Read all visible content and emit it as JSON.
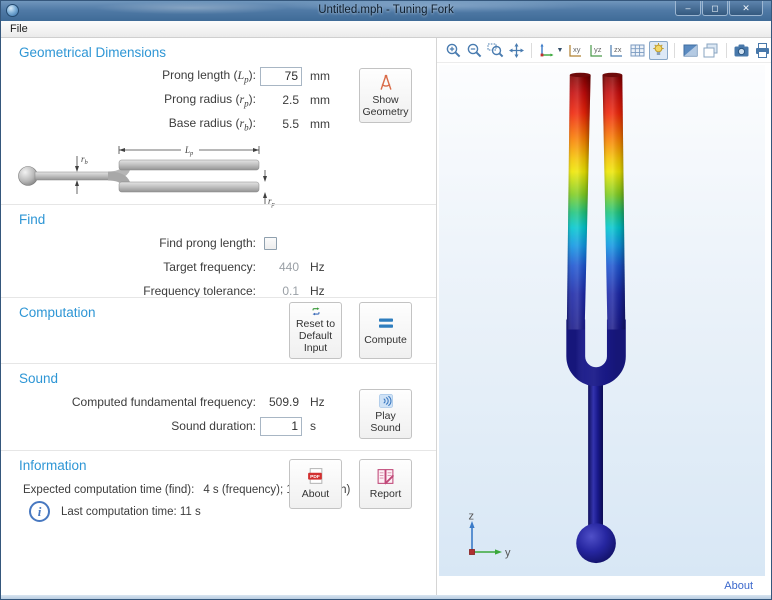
{
  "window": {
    "title": "Untitled.mph - Tuning Fork",
    "menu_items": [
      "File"
    ],
    "controls": {
      "minimize": "–",
      "maximize": "◻",
      "close": "✕"
    }
  },
  "form": {
    "geometry": {
      "title": "Geometrical Dimensions",
      "rows": [
        {
          "label_prefix": "Prong length (",
          "symbol": "L",
          "subscript": "p",
          "label_suffix": "):",
          "value": "75",
          "unit": "mm"
        },
        {
          "label_prefix": "Prong radius (",
          "symbol": "r",
          "subscript": "p",
          "label_suffix": "):",
          "value": "2.5",
          "unit": "mm"
        },
        {
          "label_prefix": "Base radius (",
          "symbol": "r",
          "subscript": "b",
          "label_suffix": "):",
          "value": "5.5",
          "unit": "mm"
        }
      ],
      "show_geometry_button": "Show Geometry",
      "diagram_labels": {
        "length": {
          "symbol": "L",
          "subscript": "p"
        },
        "base_radius": {
          "symbol": "r",
          "subscript": "b"
        },
        "prong_radius": {
          "symbol": "r",
          "subscript": "p"
        }
      }
    },
    "find": {
      "title": "Find",
      "checkbox_label": "Find prong length:",
      "rows": [
        {
          "label": "Target frequency:",
          "value": "440",
          "unit": "Hz"
        },
        {
          "label": "Frequency tolerance:",
          "value": "0.1",
          "unit": "Hz"
        }
      ]
    },
    "computation": {
      "title": "Computation",
      "reset_button": "Reset to Default Input",
      "compute_button": "Compute"
    },
    "sound": {
      "title": "Sound",
      "rows": [
        {
          "label": "Computed fundamental frequency:",
          "value": "509.9",
          "unit": "Hz"
        },
        {
          "label": "Sound duration:",
          "value": "1",
          "unit": "s"
        }
      ],
      "play_button": "Play Sound"
    },
    "information": {
      "title": "Information",
      "expected_label": "Expected computation time (find):",
      "expected_value": "4 s (frequency); 14 s (length)",
      "last_computation": "Last computation time: 11 s",
      "about_button": "About",
      "report_button": "Report"
    }
  },
  "graphics": {
    "toolbar_icons": [
      "zoom-in",
      "zoom-out",
      "zoom-box",
      "zoom-extents",
      "go-to-default-3d-view",
      "go-to-xy-view",
      "go-to-yz-view",
      "go-to-zx-view",
      "show-grid",
      "scene-light",
      "transparency",
      "copy-image",
      "image-snapshot",
      "print"
    ],
    "view_labels": {
      "xy": "xy",
      "yz": "yz",
      "zx": "zx"
    },
    "axis": {
      "vertical": "z",
      "horizontal": "y"
    },
    "about_link": "About"
  },
  "colors": {
    "accent_heading": "#2e96d5",
    "titlebar_blue": "#4a7199",
    "canvas_top": "#fcfdfe",
    "canvas_bottom": "#d8e7f5",
    "fork_navy": "#1a1a8e",
    "rainbow_scale": [
      "#7f0000",
      "#e81010",
      "#f87800",
      "#f0e000",
      "#58c838",
      "#00c8c8",
      "#1864d8",
      "#1a1a8e"
    ]
  }
}
